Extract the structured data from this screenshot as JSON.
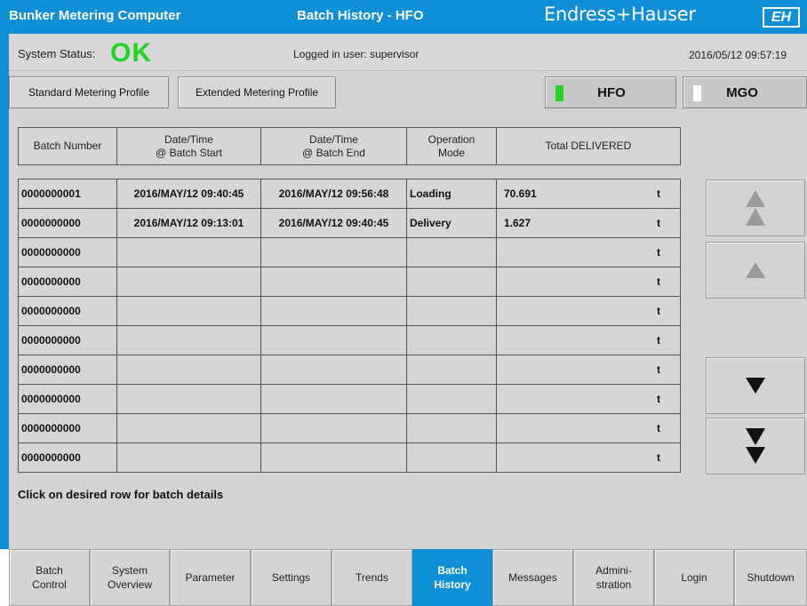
{
  "header": {
    "app_title": "Bunker Metering Computer",
    "screen_title": "Batch History - HFO",
    "brand": "Endress+Hauser",
    "logo_text": "EH"
  },
  "status": {
    "label": "System Status:",
    "value": "OK",
    "user": "Logged in user: supervisor",
    "datetime": "2016/05/12 09:57:19"
  },
  "toolbar": {
    "standard_profile": "Standard Metering Profile",
    "extended_profile": "Extended Metering Profile",
    "hfo": "HFO",
    "mgo": "MGO",
    "hfo_indicator_color": "#22d322",
    "mgo_indicator_color": "#ffffff"
  },
  "table": {
    "columns": [
      {
        "line1": "Batch Number",
        "line2": ""
      },
      {
        "line1": "Date/Time",
        "line2": "@ Batch Start"
      },
      {
        "line1": "Date/Time",
        "line2": "@ Batch End"
      },
      {
        "line1": "Operation",
        "line2": "Mode"
      },
      {
        "line1": "Total DELIVERED",
        "line2": ""
      }
    ],
    "rows": [
      {
        "batch": "0000000001",
        "start": "2016/MAY/12 09:40:45",
        "end": "2016/MAY/12 09:56:48",
        "mode": "Loading",
        "total": "70.691",
        "unit": "t"
      },
      {
        "batch": "0000000000",
        "start": "2016/MAY/12 09:13:01",
        "end": "2016/MAY/12 09:40:45",
        "mode": "Delivery",
        "total": "1.627",
        "unit": "t"
      },
      {
        "batch": "0000000000",
        "start": "",
        "end": "",
        "mode": "",
        "total": "",
        "unit": "t"
      },
      {
        "batch": "0000000000",
        "start": "",
        "end": "",
        "mode": "",
        "total": "",
        "unit": "t"
      },
      {
        "batch": "0000000000",
        "start": "",
        "end": "",
        "mode": "",
        "total": "",
        "unit": "t"
      },
      {
        "batch": "0000000000",
        "start": "",
        "end": "",
        "mode": "",
        "total": "",
        "unit": "t"
      },
      {
        "batch": "0000000000",
        "start": "",
        "end": "",
        "mode": "",
        "total": "",
        "unit": "t"
      },
      {
        "batch": "0000000000",
        "start": "",
        "end": "",
        "mode": "",
        "total": "",
        "unit": "t"
      },
      {
        "batch": "0000000000",
        "start": "",
        "end": "",
        "mode": "",
        "total": "",
        "unit": "t"
      },
      {
        "batch": "0000000000",
        "start": "",
        "end": "",
        "mode": "",
        "total": "",
        "unit": "t"
      }
    ]
  },
  "scroll": {
    "page_up_icon": "double-up-arrow-icon",
    "up_icon": "up-arrow-icon",
    "down_icon": "down-arrow-icon",
    "page_down_icon": "double-down-arrow-icon"
  },
  "hint": "Click on desired row for batch details",
  "nav": [
    {
      "line1": "Batch",
      "line2": "Control",
      "active": false
    },
    {
      "line1": "System",
      "line2": "Overview",
      "active": false
    },
    {
      "line1": "Parameter",
      "line2": "",
      "active": false
    },
    {
      "line1": "Settings",
      "line2": "",
      "active": false
    },
    {
      "line1": "Trends",
      "line2": "",
      "active": false
    },
    {
      "line1": "Batch",
      "line2": "History",
      "active": true
    },
    {
      "line1": "Messages",
      "line2": "",
      "active": false
    },
    {
      "line1": "Admini-",
      "line2": "stration",
      "active": false
    },
    {
      "line1": "Login",
      "line2": "",
      "active": false
    },
    {
      "line1": "Shutdown",
      "line2": "",
      "active": false
    }
  ],
  "colors": {
    "brand_blue": "#0f8fd6",
    "status_ok": "#22d322",
    "panel_gray": "#d3d3d3"
  }
}
